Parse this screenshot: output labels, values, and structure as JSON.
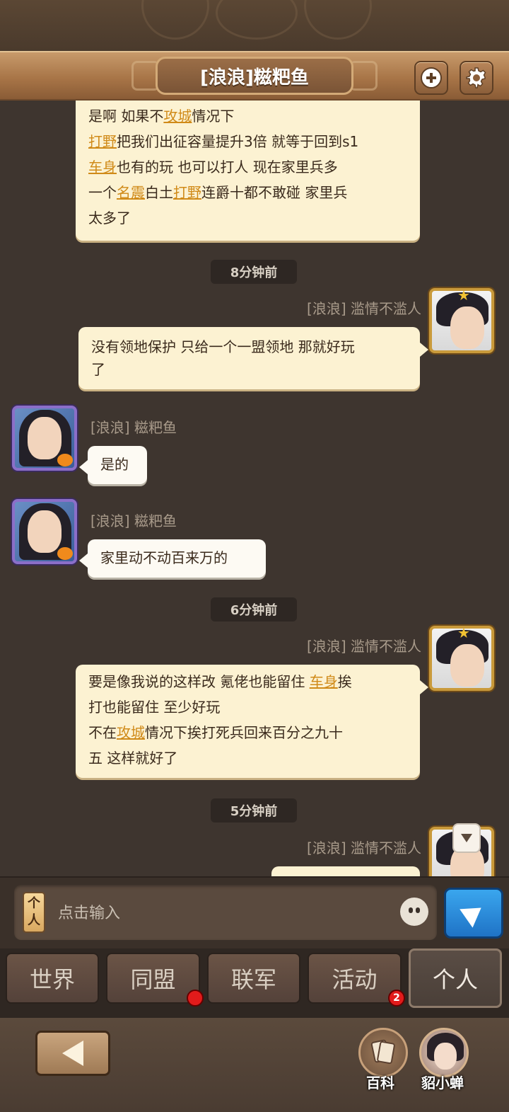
{
  "header": {
    "title": "[浪浪]糍粑鱼"
  },
  "messages": {
    "m1": {
      "p1": "是啊  如果不",
      "k1": "攻城",
      "p2": "情况下",
      "k2": "打野",
      "p3": "把我们出征容量提升3倍 就等于回到s1",
      "k3": "车身",
      "p4": "也有的玩  也可以打人   现在家里兵多",
      "p5": " 一个",
      "k4": "名震",
      "p6": "白土",
      "k5": "打野",
      "p7": "连爵十都不敢碰  家里兵",
      "p8": "太多了"
    },
    "t1": "8分钟前",
    "m2": {
      "name": "[浪浪] 滥情不滥人",
      "line1": "没有领地保护 只给一个一盟领地 那就好玩",
      "line2": "了"
    },
    "m3": {
      "name": "[浪浪] 糍粑鱼",
      "text": "是的"
    },
    "m4": {
      "name": "[浪浪] 糍粑鱼",
      "text": "家里动不动百来万的"
    },
    "t2": "6分钟前",
    "m5": {
      "name": "[浪浪] 滥情不滥人",
      "p1": "要是像我说的这样改 氪佬也能留住 ",
      "k1": "车身",
      "p2": "挨",
      "p3": "打也能留住   至少好玩",
      "p4": " 不在",
      "k2": "攻城",
      "p5": "情况下挨打死兵回来百分之九十",
      "p6": "五  这样就好了"
    },
    "t3": "5分钟前",
    "m6": {
      "name": "[浪浪] 滥情不滥人"
    }
  },
  "input": {
    "tag": "个\n人",
    "placeholder": "点击输入"
  },
  "tabs": [
    {
      "label": "世界"
    },
    {
      "label": "同盟"
    },
    {
      "label": "联军"
    },
    {
      "label": "活动",
      "badge": "2"
    },
    {
      "label": "个人"
    }
  ],
  "bottom": {
    "encyclopedia": "百科",
    "assistant": "貂小蝉"
  },
  "colors": {
    "keyword": "#d08a18",
    "send": "#2a8de0",
    "badge": "#e21b1b"
  }
}
